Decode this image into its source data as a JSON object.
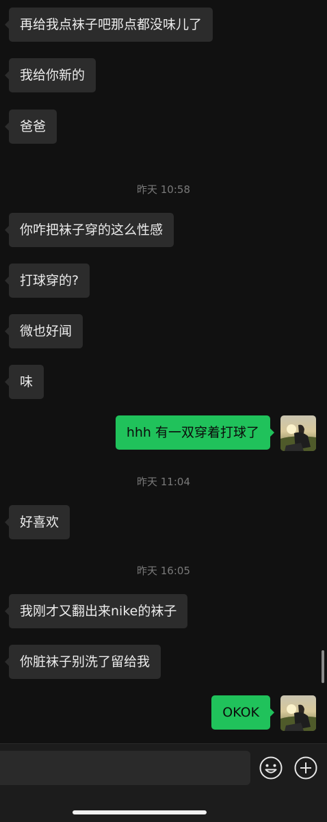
{
  "chat": {
    "messages": [
      {
        "text": "再给我点袜子吧那点都没味儿了"
      },
      {
        "text": "我给你新的"
      },
      {
        "text": "爸爸"
      },
      {
        "time": "昨天 10:58"
      },
      {
        "text": "你咋把袜子穿的这么性感"
      },
      {
        "text": "打球穿的?"
      },
      {
        "text": "微也好闻"
      },
      {
        "text": "味"
      },
      {
        "text": "hhh 有一双穿着打球了"
      },
      {
        "time": "昨天 11:04"
      },
      {
        "text": "好喜欢"
      },
      {
        "time": "昨天 16:05"
      },
      {
        "text": "我刚才又翻出来nike的袜子"
      },
      {
        "text": "你脏袜子别洗了留给我"
      },
      {
        "text": "OKOK"
      }
    ]
  },
  "input_bar": {
    "placeholder": "",
    "icons": [
      "emoji-icon",
      "plus-icon"
    ]
  },
  "colors": {
    "background": "#111111",
    "incoming_bubble": "#2c2c2c",
    "outgoing_bubble": "#20c25b"
  }
}
